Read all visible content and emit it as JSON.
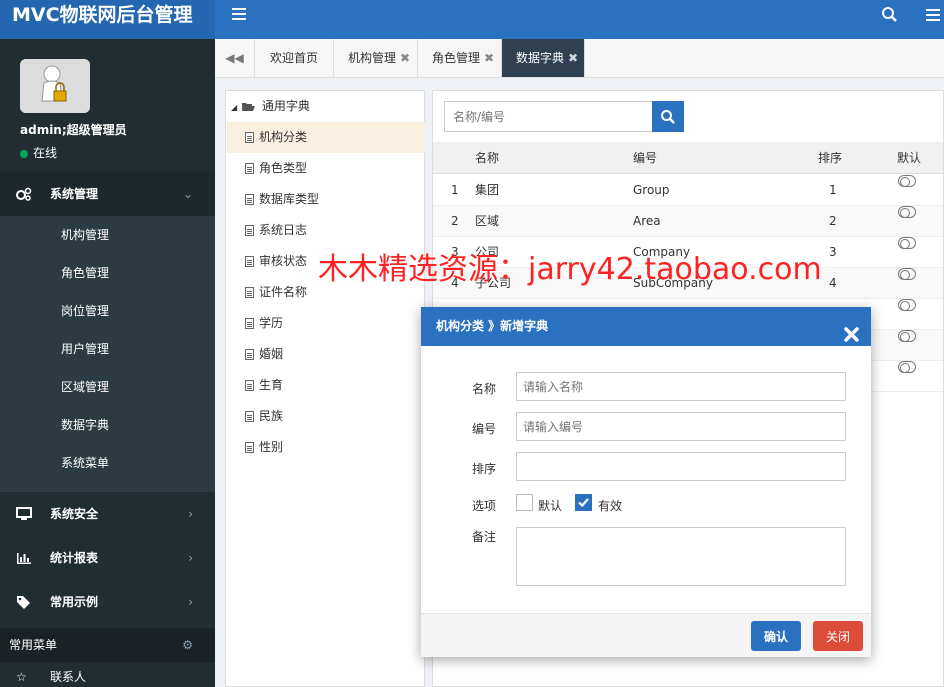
{
  "app": {
    "title": "MVC物联网后台管理"
  },
  "user": {
    "name": "admin;超级管理员",
    "status": "在线"
  },
  "sidebar": {
    "groups": [
      {
        "label": "系统管理",
        "icon": "cogs-icon"
      },
      {
        "label": "系统安全",
        "icon": "monitor-icon"
      },
      {
        "label": "统计报表",
        "icon": "bar-chart-icon"
      },
      {
        "label": "常用示例",
        "icon": "tags-icon"
      }
    ],
    "submenu": [
      "机构管理",
      "角色管理",
      "岗位管理",
      "用户管理",
      "区域管理",
      "数据字典",
      "系统菜单"
    ],
    "quick_title": "常用菜单",
    "quick_items": [
      "联系人"
    ]
  },
  "tabs": [
    {
      "label": "欢迎首页",
      "closable": false
    },
    {
      "label": "机构管理",
      "closable": true
    },
    {
      "label": "角色管理",
      "closable": true
    },
    {
      "label": "数据字典",
      "closable": true
    }
  ],
  "tab_close_glyph": "✖",
  "tree": {
    "root": "通用字典",
    "items": [
      "机构分类",
      "角色类型",
      "数据库类型",
      "系统日志",
      "审核状态",
      "证件名称",
      "学历",
      "婚姻",
      "生育",
      "民族",
      "性别"
    ]
  },
  "grid": {
    "search_placeholder": "名称/编号",
    "columns": [
      "名称",
      "编号",
      "排序",
      "默认"
    ],
    "rows": [
      {
        "no": "1",
        "name": "集团",
        "code": "Group",
        "sort": "1"
      },
      {
        "no": "2",
        "name": "区域",
        "code": "Area",
        "sort": "2"
      },
      {
        "no": "3",
        "name": "公司",
        "code": "Company",
        "sort": "3"
      },
      {
        "no": "4",
        "name": "子公司",
        "code": "SubCompany",
        "sort": "4"
      }
    ]
  },
  "watermark": "木木精选资源：jarry42.taobao.com",
  "modal": {
    "title": "机构分类 》新增字典",
    "fields": {
      "name": {
        "label": "名称",
        "placeholder": "请输入名称"
      },
      "code": {
        "label": "编号",
        "placeholder": "请输入编号"
      },
      "sort": {
        "label": "排序",
        "placeholder": ""
      },
      "options": {
        "label": "选项",
        "default_label": "默认",
        "valid_label": "有效",
        "default_checked": false,
        "valid_checked": true
      },
      "remark": {
        "label": "备注"
      }
    },
    "ok_label": "确认",
    "close_label": "关闭"
  },
  "colors": {
    "primary": "#2a72c0",
    "sidebar": "#222d32",
    "danger": "#dd4b39",
    "watermark": "#ff2222"
  }
}
